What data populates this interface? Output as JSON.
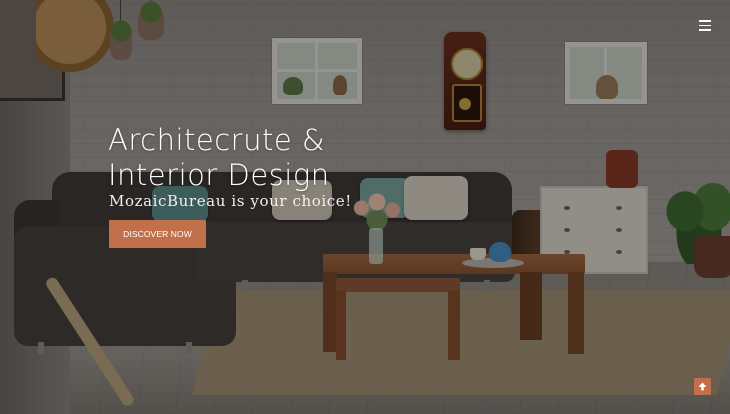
{
  "hero": {
    "title_line1": "Architecrute &",
    "title_line2": "Interior Design",
    "tagline": "MozaicBureau is your choice!",
    "cta_label": "DISCOVER NOW",
    "background_image": "living-room-photo"
  },
  "nav": {
    "menu_icon": "hamburger-menu-icon"
  },
  "floating": {
    "scroll_top_icon": "arrow-up-icon"
  },
  "colors": {
    "accent": "#c26f4b",
    "text": "#ffffff"
  }
}
